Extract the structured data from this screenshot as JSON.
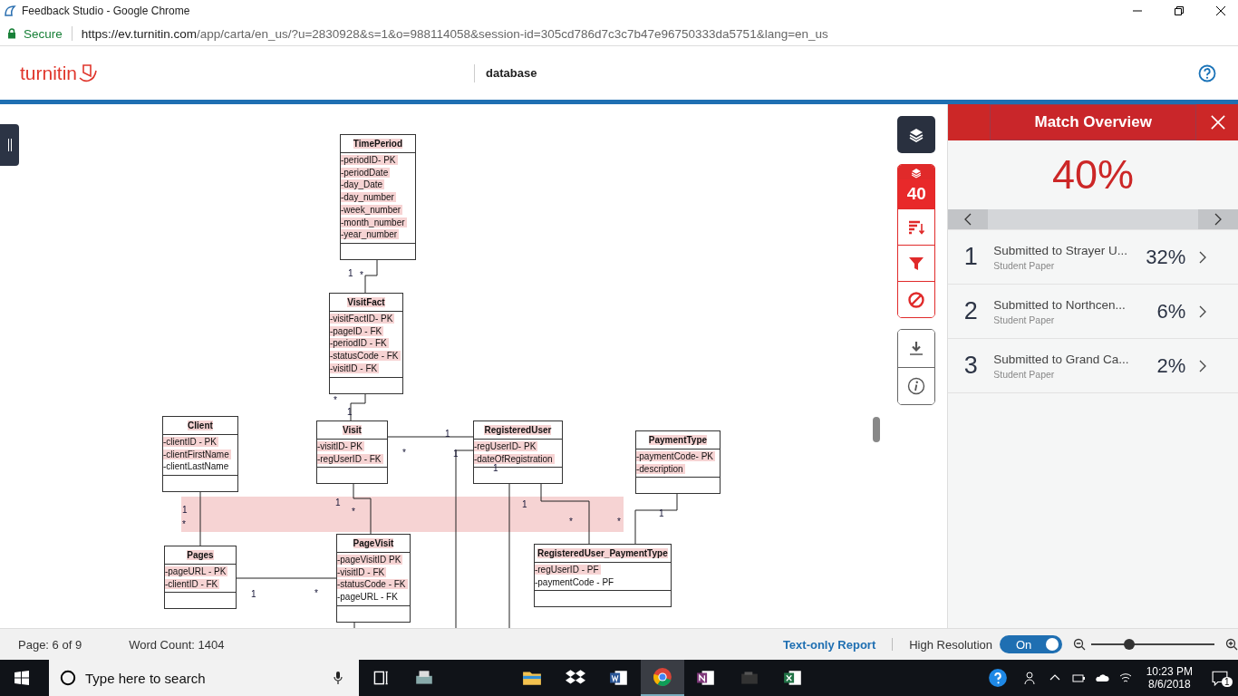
{
  "browser": {
    "title": "Feedback Studio - Google Chrome",
    "secure_label": "Secure",
    "url_host": "https://ev.turnitin.com",
    "url_path": "/app/carta/en_us/?u=2830928&s=1&o=988114058&session-id=305cd786d7c3c7b47e96750333da5751&lang=en_us"
  },
  "header": {
    "logo": "turnitin",
    "document_title": "database"
  },
  "diagram": {
    "entities": [
      {
        "name": "TimePeriod",
        "attributes": [
          {
            "text": "-periodID- PK",
            "highlighted": true
          },
          {
            "text": "-periodDate",
            "highlighted": true
          },
          {
            "text": "-day_Date",
            "highlighted": true
          },
          {
            "text": "-day_number",
            "highlighted": true
          },
          {
            "text": "-week_number",
            "highlighted": true
          },
          {
            "text": "-month_number",
            "highlighted": true
          },
          {
            "text": "-year_number",
            "highlighted": true
          }
        ]
      },
      {
        "name": "VisitFact",
        "attributes": [
          {
            "text": "-visitFactID- PK",
            "highlighted": true
          },
          {
            "text": "-pageID - FK",
            "highlighted": true
          },
          {
            "text": "-periodID - FK",
            "highlighted": true
          },
          {
            "text": "-statusCode - FK",
            "highlighted": true
          },
          {
            "text": "-visitID - FK",
            "highlighted": true
          }
        ]
      },
      {
        "name": "Client",
        "attributes": [
          {
            "text": "-clientID - PK",
            "highlighted": true
          },
          {
            "text": "-clientFirstName",
            "highlighted": true
          },
          {
            "text": "-clientLastName",
            "highlighted": false
          }
        ]
      },
      {
        "name": "Visit",
        "attributes": [
          {
            "text": "-visitID- PK",
            "highlighted": true
          },
          {
            "text": "-regUserID - FK",
            "highlighted": true
          }
        ]
      },
      {
        "name": "RegisteredUser",
        "attributes": [
          {
            "text": "-regUserID- PK",
            "highlighted": true
          },
          {
            "text": "-dateOfRegistration",
            "highlighted": true
          }
        ]
      },
      {
        "name": "PaymentType",
        "attributes": [
          {
            "text": "-paymentCode- PK",
            "highlighted": true
          },
          {
            "text": "-description",
            "highlighted": true
          }
        ]
      },
      {
        "name": "Pages",
        "attributes": [
          {
            "text": "-pageURL - PK",
            "highlighted": true
          },
          {
            "text": "-clientID - FK",
            "highlighted": true
          }
        ]
      },
      {
        "name": "PageVisit",
        "attributes": [
          {
            "text": "-pageVisitID PK",
            "highlighted": true
          },
          {
            "text": "-visitID - FK",
            "highlighted": true
          },
          {
            "text": "-statusCode - FK",
            "highlighted": true
          },
          {
            "text": "-pageURL - FK",
            "highlighted": false
          }
        ]
      },
      {
        "name": "RegisteredUser_PaymentType",
        "attributes": [
          {
            "text": "-regUserID - PF",
            "highlighted": true
          },
          {
            "text": "-paymentCode - PF",
            "highlighted": false
          }
        ]
      }
    ],
    "multiplicities": [
      "1",
      "*",
      "*",
      "1",
      "1",
      "*",
      "1",
      "1",
      "1",
      "*",
      "1",
      "*",
      "1",
      "*",
      "*",
      "1",
      "1",
      "*"
    ]
  },
  "toolbar": {
    "score": "40"
  },
  "match_overview": {
    "title": "Match Overview",
    "score": "40%",
    "matches": [
      {
        "number": "1",
        "source": "Submitted to Strayer U...",
        "type": "Student Paper",
        "percent": "32%"
      },
      {
        "number": "2",
        "source": "Submitted to Northcen...",
        "type": "Student Paper",
        "percent": "6%"
      },
      {
        "number": "3",
        "source": "Submitted to Grand Ca...",
        "type": "Student Paper",
        "percent": "2%"
      }
    ]
  },
  "status_bar": {
    "page": "Page: 6 of 9",
    "word_count": "Word Count: 1404",
    "text_only_link": "Text-only Report",
    "resolution_label": "High Resolution",
    "resolution_toggle": {
      "label": "On",
      "on": true
    },
    "zoom": {
      "level": 0.31
    }
  },
  "taskbar": {
    "search_placeholder": "Type here to search",
    "time": "10:23 PM",
    "date": "8/6/2018",
    "notifications": "1"
  }
}
